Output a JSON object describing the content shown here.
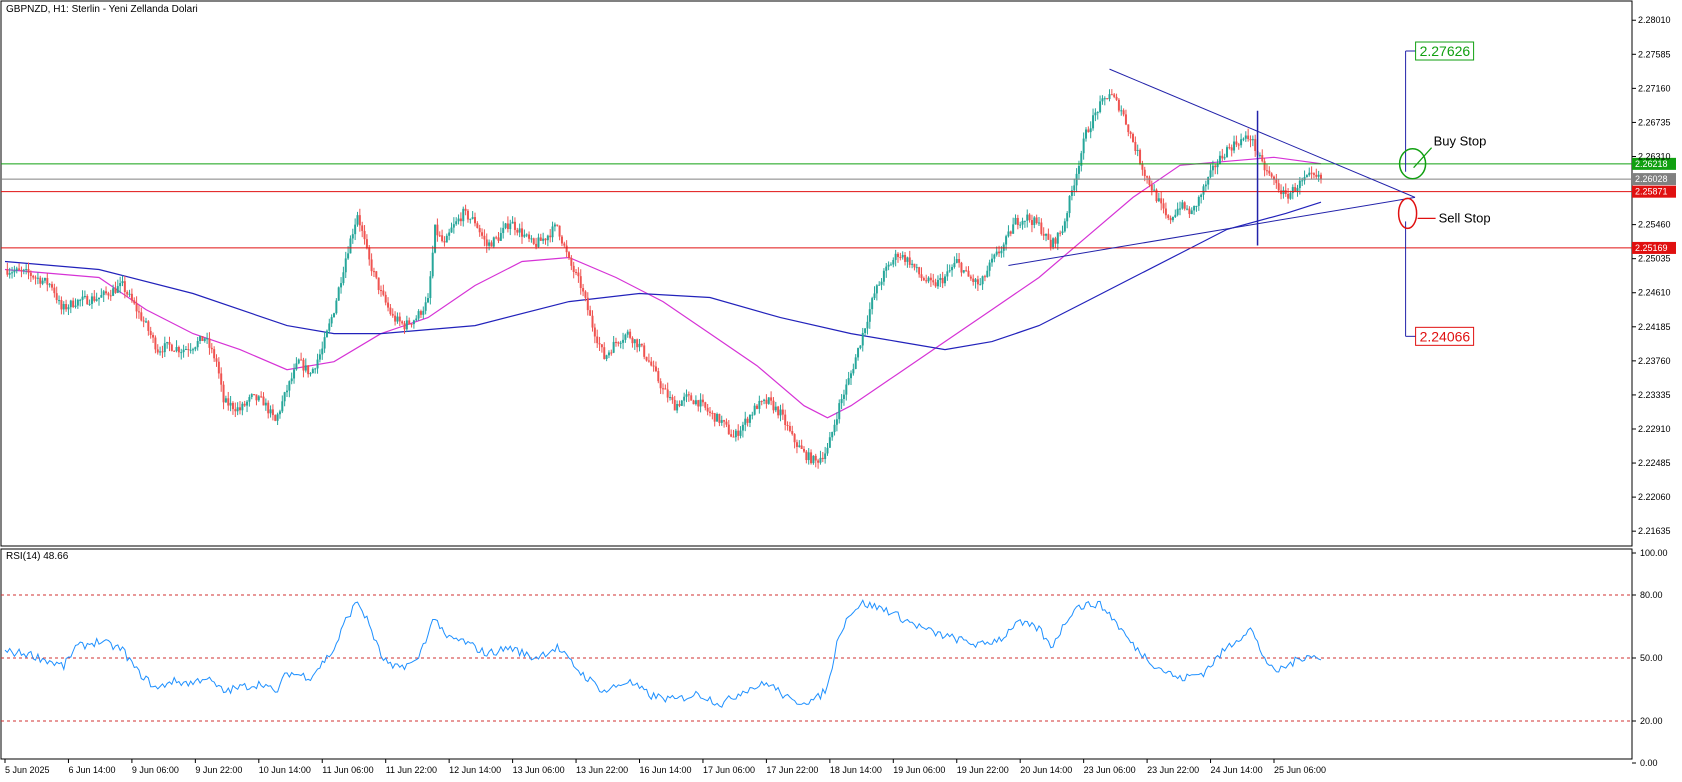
{
  "header": {
    "title": "GBPNZD, H1:  Sterlin - Yeni Zellanda Dolari",
    "rsi_label": "RSI(14) 48.66"
  },
  "colors": {
    "bull": "#26a69a",
    "bear": "#ef5350",
    "ma_fast": "#d633d6",
    "ma_slow": "#2222bb",
    "trend": "#2222aa",
    "green_line": "#11a011",
    "red_line": "#e01010",
    "grey_line": "#808080",
    "rsi_line": "#1e90ff",
    "rsi_level": "#d03030"
  },
  "chart_data": [
    {
      "type": "candlestick",
      "symbol": "GBPNZD",
      "timeframe": "H1",
      "ylim": [
        2.2145,
        2.2825
      ],
      "y_ticks": [
        "2.28010",
        "2.27585",
        "2.27160",
        "2.26735",
        "2.26310",
        "2.25460",
        "2.25035",
        "2.24610",
        "2.24185",
        "2.23760",
        "2.23335",
        "2.22910",
        "2.22485",
        "2.22060",
        "2.21635"
      ],
      "x_ticks": [
        "5 Jun 2025",
        "6 Jun 14:00",
        "9 Jun 06:00",
        "9 Jun 22:00",
        "10 Jun 14:00",
        "11 Jun 06:00",
        "11 Jun 22:00",
        "12 Jun 14:00",
        "13 Jun 06:00",
        "13 Jun 22:00",
        "16 Jun 14:00",
        "17 Jun 06:00",
        "17 Jun 22:00",
        "18 Jun 14:00",
        "19 Jun 06:00",
        "19 Jun 22:00",
        "20 Jun 14:00",
        "23 Jun 06:00",
        "23 Jun 22:00",
        "24 Jun 14:00",
        "25 Jun 06:00"
      ],
      "close_path": [
        [
          0,
          2.249
        ],
        [
          10,
          2.2485
        ],
        [
          20,
          2.247
        ],
        [
          24,
          2.244
        ],
        [
          30,
          2.245
        ],
        [
          40,
          2.2455
        ],
        [
          50,
          2.247
        ],
        [
          56,
          2.244
        ],
        [
          60,
          2.242
        ],
        [
          65,
          2.239
        ],
        [
          70,
          2.2395
        ],
        [
          75,
          2.239
        ],
        [
          80,
          2.2395
        ],
        [
          85,
          2.2405
        ],
        [
          90,
          2.2375
        ],
        [
          93,
          2.2325
        ],
        [
          100,
          2.2315
        ],
        [
          105,
          2.233
        ],
        [
          110,
          2.2325
        ],
        [
          115,
          2.23
        ],
        [
          120,
          2.234
        ],
        [
          125,
          2.2375
        ],
        [
          130,
          2.236
        ],
        [
          135,
          2.239
        ],
        [
          140,
          2.244
        ],
        [
          145,
          2.2505
        ],
        [
          150,
          2.256
        ],
        [
          155,
          2.25
        ],
        [
          160,
          2.246
        ],
        [
          165,
          2.243
        ],
        [
          170,
          2.242
        ],
        [
          175,
          2.243
        ],
        [
          180,
          2.245
        ],
        [
          183,
          2.254
        ],
        [
          187,
          2.252
        ],
        [
          190,
          2.254
        ],
        [
          195,
          2.256
        ],
        [
          200,
          2.255
        ],
        [
          205,
          2.252
        ],
        [
          210,
          2.253
        ],
        [
          215,
          2.255
        ],
        [
          220,
          2.2535
        ],
        [
          225,
          2.252
        ],
        [
          230,
          2.253
        ],
        [
          235,
          2.2545
        ],
        [
          240,
          2.25
        ],
        [
          245,
          2.247
        ],
        [
          250,
          2.242
        ],
        [
          255,
          2.238
        ],
        [
          260,
          2.24
        ],
        [
          265,
          2.241
        ],
        [
          270,
          2.2395
        ],
        [
          275,
          2.237
        ],
        [
          280,
          2.234
        ],
        [
          285,
          2.232
        ],
        [
          290,
          2.233
        ],
        [
          295,
          2.2325
        ],
        [
          300,
          2.231
        ],
        [
          305,
          2.23
        ],
        [
          310,
          2.228
        ],
        [
          315,
          2.23
        ],
        [
          320,
          2.232
        ],
        [
          325,
          2.2325
        ],
        [
          330,
          2.231
        ],
        [
          335,
          2.228
        ],
        [
          340,
          2.226
        ],
        [
          345,
          2.225
        ],
        [
          350,
          2.2265
        ],
        [
          355,
          2.232
        ],
        [
          360,
          2.236
        ],
        [
          365,
          2.241
        ],
        [
          370,
          2.246
        ],
        [
          375,
          2.249
        ],
        [
          380,
          2.251
        ],
        [
          385,
          2.25
        ],
        [
          390,
          2.248
        ],
        [
          395,
          2.247
        ],
        [
          400,
          2.248
        ],
        [
          405,
          2.25
        ],
        [
          410,
          2.248
        ],
        [
          415,
          2.247
        ],
        [
          420,
          2.25
        ],
        [
          425,
          2.252
        ],
        [
          430,
          2.255
        ],
        [
          435,
          2.2555
        ],
        [
          440,
          2.2545
        ],
        [
          445,
          2.252
        ],
        [
          450,
          2.254
        ],
        [
          455,
          2.26
        ],
        [
          460,
          2.266
        ],
        [
          465,
          2.269
        ],
        [
          470,
          2.271
        ],
        [
          475,
          2.269
        ],
        [
          480,
          2.265
        ],
        [
          485,
          2.261
        ],
        [
          490,
          2.258
        ],
        [
          495,
          2.255
        ],
        [
          500,
          2.257
        ],
        [
          505,
          2.256
        ],
        [
          510,
          2.259
        ],
        [
          515,
          2.262
        ],
        [
          520,
          2.264
        ],
        [
          525,
          2.265
        ],
        [
          530,
          2.2655
        ],
        [
          535,
          2.262
        ],
        [
          540,
          2.26
        ],
        [
          545,
          2.258
        ],
        [
          550,
          2.2595
        ],
        [
          555,
          2.2605
        ],
        [
          560,
          2.2603
        ]
      ],
      "series": [
        {
          "name": "",
          "kind": "moving-average",
          "path": [
            [
              0,
              2.249
            ],
            [
              20,
              2.2485
            ],
            [
              40,
              2.248
            ],
            [
              60,
              2.244
            ],
            [
              80,
              2.241
            ],
            [
              100,
              2.239
            ],
            [
              120,
              2.2365
            ],
            [
              140,
              2.2375
            ],
            [
              160,
              2.241
            ],
            [
              180,
              2.243
            ],
            [
              200,
              2.247
            ],
            [
              220,
              2.25
            ],
            [
              240,
              2.2505
            ],
            [
              260,
              2.248
            ],
            [
              280,
              2.245
            ],
            [
              300,
              2.241
            ],
            [
              320,
              2.237
            ],
            [
              340,
              2.232
            ],
            [
              350,
              2.2305
            ],
            [
              360,
              2.232
            ],
            [
              380,
              2.236
            ],
            [
              400,
              2.24
            ],
            [
              420,
              2.244
            ],
            [
              440,
              2.248
            ],
            [
              460,
              2.253
            ],
            [
              480,
              2.258
            ],
            [
              500,
              2.262
            ],
            [
              520,
              2.2625
            ],
            [
              540,
              2.263
            ],
            [
              560,
              2.2622
            ]
          ]
        },
        {
          "name": "",
          "kind": "moving-average",
          "path": [
            [
              0,
              2.25
            ],
            [
              40,
              2.249
            ],
            [
              80,
              2.246
            ],
            [
              120,
              2.242
            ],
            [
              140,
              2.241
            ],
            [
              160,
              2.241
            ],
            [
              200,
              2.242
            ],
            [
              240,
              2.245
            ],
            [
              270,
              2.246
            ],
            [
              300,
              2.2455
            ],
            [
              330,
              2.243
            ],
            [
              360,
              2.241
            ],
            [
              380,
              2.24
            ],
            [
              400,
              2.239
            ],
            [
              420,
              2.24
            ],
            [
              440,
              2.242
            ],
            [
              460,
              2.245
            ],
            [
              480,
              2.248
            ],
            [
              500,
              2.251
            ],
            [
              520,
              2.254
            ],
            [
              545,
              2.256
            ],
            [
              560,
              2.2574
            ]
          ]
        }
      ],
      "horizontal_lines": [
        {
          "value": 2.26218,
          "label": "2.26218",
          "color": "green"
        },
        {
          "value": 2.26028,
          "label": "2.26028",
          "color": "grey"
        },
        {
          "value": 2.25871,
          "label": "2.25871",
          "color": "red"
        },
        {
          "value": 2.25169,
          "label": "2.25169",
          "color": "red"
        }
      ],
      "triangle": {
        "upper": [
          [
            470,
            2.274
          ],
          [
            600,
            2.258
          ]
        ],
        "lower": [
          [
            427,
            2.2495
          ],
          [
            600,
            2.258
          ]
        ],
        "verticals": [
          [
            533,
            2.2688,
            2.252
          ]
        ]
      },
      "targets": [
        {
          "label": "2.27626",
          "value": 2.27626,
          "color": "green"
        },
        {
          "label": "2.24066",
          "value": 2.24066,
          "color": "red"
        }
      ],
      "annotations": [
        "Buy Stop",
        "Sell Stop"
      ]
    },
    {
      "type": "line",
      "name": "RSI(14)",
      "ylim": [
        0,
        100
      ],
      "y_ticks": [
        "100.00",
        "80.00",
        "50.00",
        "20.00",
        "0.00"
      ],
      "levels": [
        80,
        50,
        20
      ],
      "path": [
        [
          0,
          53
        ],
        [
          10,
          52
        ],
        [
          20,
          48
        ],
        [
          25,
          46
        ],
        [
          30,
          55
        ],
        [
          40,
          58
        ],
        [
          50,
          54
        ],
        [
          56,
          44
        ],
        [
          60,
          40
        ],
        [
          65,
          35
        ],
        [
          70,
          39
        ],
        [
          80,
          38
        ],
        [
          85,
          41
        ],
        [
          93,
          34
        ],
        [
          100,
          36
        ],
        [
          110,
          38
        ],
        [
          115,
          33
        ],
        [
          120,
          43
        ],
        [
          130,
          41
        ],
        [
          140,
          54
        ],
        [
          145,
          68
        ],
        [
          150,
          77
        ],
        [
          155,
          66
        ],
        [
          160,
          51
        ],
        [
          165,
          45
        ],
        [
          175,
          48
        ],
        [
          183,
          70
        ],
        [
          187,
          60
        ],
        [
          195,
          58
        ],
        [
          205,
          52
        ],
        [
          215,
          55
        ],
        [
          225,
          50
        ],
        [
          235,
          55
        ],
        [
          245,
          43
        ],
        [
          255,
          34
        ],
        [
          265,
          39
        ],
        [
          275,
          32
        ],
        [
          285,
          30
        ],
        [
          295,
          33
        ],
        [
          305,
          28
        ],
        [
          315,
          35
        ],
        [
          325,
          38
        ],
        [
          335,
          29
        ],
        [
          345,
          30
        ],
        [
          350,
          36
        ],
        [
          355,
          62
        ],
        [
          360,
          72
        ],
        [
          365,
          76
        ],
        [
          375,
          73
        ],
        [
          385,
          67
        ],
        [
          395,
          62
        ],
        [
          405,
          59
        ],
        [
          415,
          56
        ],
        [
          425,
          60
        ],
        [
          430,
          67
        ],
        [
          440,
          64
        ],
        [
          445,
          55
        ],
        [
          455,
          74
        ],
        [
          465,
          76
        ],
        [
          470,
          71
        ],
        [
          480,
          56
        ],
        [
          490,
          46
        ],
        [
          500,
          40
        ],
        [
          510,
          43
        ],
        [
          520,
          55
        ],
        [
          530,
          64
        ],
        [
          535,
          52
        ],
        [
          540,
          43
        ],
        [
          550,
          49
        ],
        [
          555,
          52
        ],
        [
          560,
          48.66
        ]
      ]
    }
  ]
}
